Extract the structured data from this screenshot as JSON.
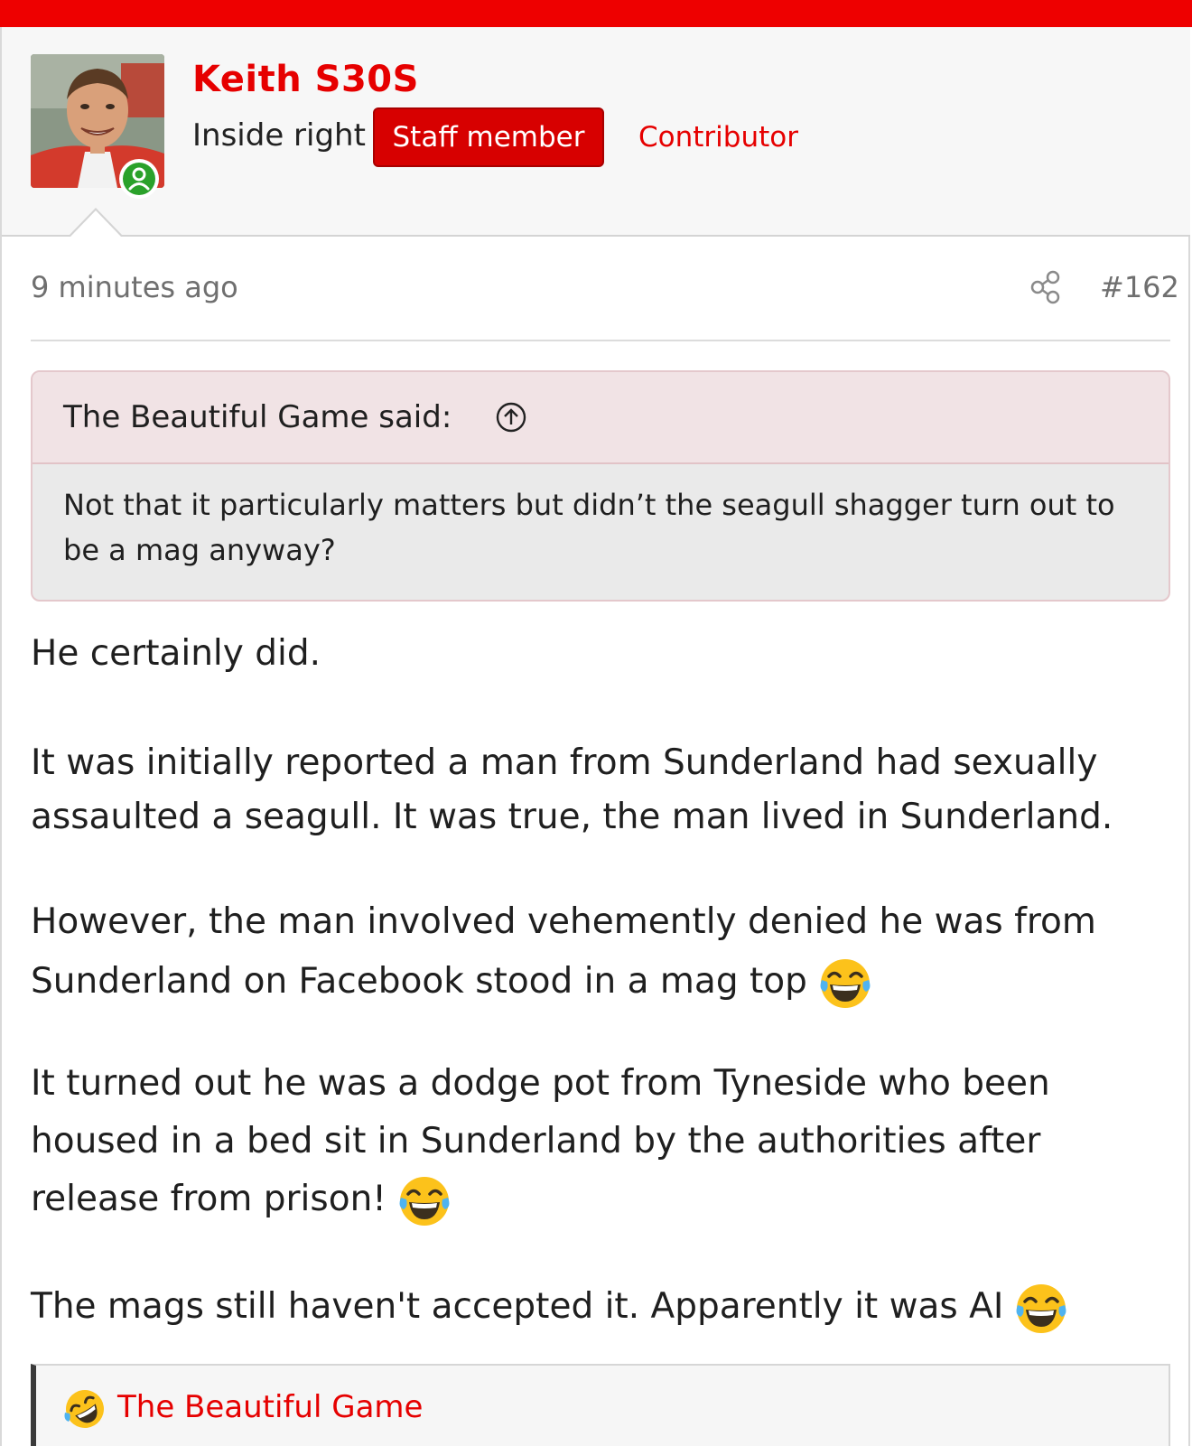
{
  "post": {
    "author": {
      "username": "Keith S30S",
      "user_title": "Inside right",
      "staff_badge": "Staff member",
      "banner": "Contributor",
      "status": "online"
    },
    "timestamp": "9 minutes ago",
    "post_number": "#162",
    "quote": {
      "author_line": "The Beautiful Game said:",
      "text": "Not that it particularly matters but didn’t the seagull shagger turn out to be a mag anyway?"
    },
    "paragraphs": [
      "He certainly did.",
      "It was initially reported a man from Sunderland had sexually assaulted a seagull. It was true, the man lived in Sunderland.",
      "However, the man involved vehemently denied he was from Sunderland on Facebook stood in a mag top",
      "It turned out he was a dodge pot from Tyneside who been housed in a bed sit in Sunderland by the authorities after release from prison!",
      "The mags still haven't accepted it. Apparently it was AI"
    ],
    "reactions": {
      "icon": "rofl-emoji",
      "users": "The Beautiful Game"
    }
  },
  "colors": {
    "accent": "#e60000",
    "topbar": "#ee0000",
    "online": "#2aa12a"
  }
}
